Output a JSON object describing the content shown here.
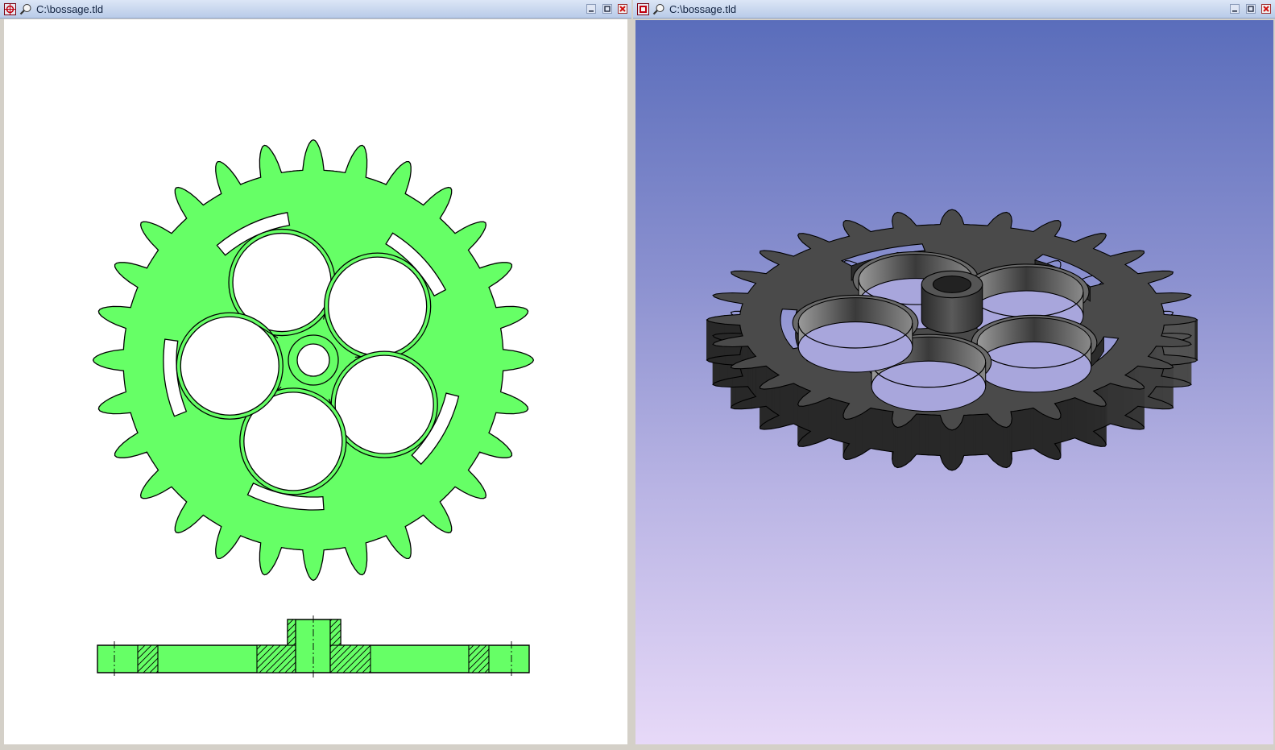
{
  "windows": [
    {
      "title": "C:\\bossage.tld",
      "view": "2D drawing",
      "colors": {
        "fill": "#66ff66",
        "outline": "#000000",
        "background": "#ffffff"
      }
    },
    {
      "title": "C:\\bossage.tld",
      "view": "3D shaded",
      "colors": {
        "solid": "#4d4d4d",
        "background_top": "#5a6dbb",
        "background_bottom": "#e7d9f8"
      }
    }
  ],
  "gear": {
    "teeth": 28,
    "lightening_holes": 5
  },
  "icons": [
    "app-icon",
    "view-icon",
    "minimize-icon",
    "maximize-icon",
    "close-icon"
  ]
}
